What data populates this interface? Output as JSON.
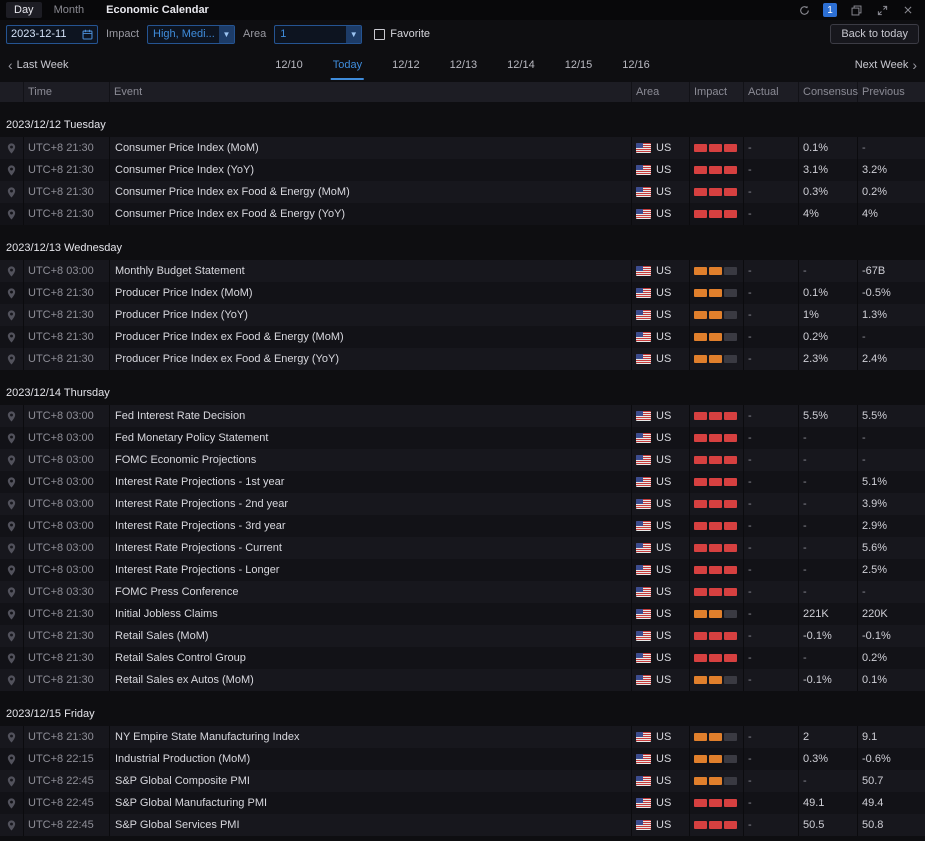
{
  "colors": {
    "accent": "#3f8cdb",
    "impact_high": "#d64040",
    "impact_medium": "#e07f2c"
  },
  "titlebar": {
    "tabs": [
      {
        "label": "Day",
        "active": true
      },
      {
        "label": "Month",
        "active": false
      }
    ],
    "title": "Economic Calendar",
    "window_count": "1"
  },
  "toolbar": {
    "date_value": "2023-12-11",
    "impact_label": "Impact",
    "impact_value": "High, Medi...",
    "area_label": "Area",
    "area_value": "1",
    "favorite_label": "Favorite",
    "back_to_today_label": "Back to today"
  },
  "week_nav": {
    "prev_label": "Last Week",
    "next_label": "Next Week",
    "days": [
      "12/10",
      "Today",
      "12/12",
      "12/13",
      "12/14",
      "12/15",
      "12/16"
    ],
    "active_index": 1
  },
  "table": {
    "columns": [
      "Time",
      "Event",
      "Area",
      "Impact",
      "Actual",
      "Consensus",
      "Previous"
    ],
    "sections": [
      {
        "date": "2023/12/12 Tuesday",
        "rows": [
          {
            "time": "UTC+8 21:30",
            "event": "Consumer Price Index (MoM)",
            "area": "US",
            "impact": "high",
            "actual": "-",
            "consensus": "0.1%",
            "previous": "-"
          },
          {
            "time": "UTC+8 21:30",
            "event": "Consumer Price Index (YoY)",
            "area": "US",
            "impact": "high",
            "actual": "-",
            "consensus": "3.1%",
            "previous": "3.2%"
          },
          {
            "time": "UTC+8 21:30",
            "event": "Consumer Price Index ex Food & Energy (MoM)",
            "area": "US",
            "impact": "high",
            "actual": "-",
            "consensus": "0.3%",
            "previous": "0.2%"
          },
          {
            "time": "UTC+8 21:30",
            "event": "Consumer Price Index ex Food & Energy (YoY)",
            "area": "US",
            "impact": "high",
            "actual": "-",
            "consensus": "4%",
            "previous": "4%"
          }
        ]
      },
      {
        "date": "2023/12/13 Wednesday",
        "rows": [
          {
            "time": "UTC+8 03:00",
            "event": "Monthly Budget Statement",
            "area": "US",
            "impact": "medium",
            "actual": "-",
            "consensus": "-",
            "previous": "-67B"
          },
          {
            "time": "UTC+8 21:30",
            "event": "Producer Price Index (MoM)",
            "area": "US",
            "impact": "medium",
            "actual": "-",
            "consensus": "0.1%",
            "previous": "-0.5%"
          },
          {
            "time": "UTC+8 21:30",
            "event": "Producer Price Index (YoY)",
            "area": "US",
            "impact": "medium",
            "actual": "-",
            "consensus": "1%",
            "previous": "1.3%"
          },
          {
            "time": "UTC+8 21:30",
            "event": "Producer Price Index ex Food & Energy (MoM)",
            "area": "US",
            "impact": "medium",
            "actual": "-",
            "consensus": "0.2%",
            "previous": "-"
          },
          {
            "time": "UTC+8 21:30",
            "event": "Producer Price Index ex Food & Energy (YoY)",
            "area": "US",
            "impact": "medium",
            "actual": "-",
            "consensus": "2.3%",
            "previous": "2.4%"
          }
        ]
      },
      {
        "date": "2023/12/14 Thursday",
        "rows": [
          {
            "time": "UTC+8 03:00",
            "event": "Fed Interest Rate Decision",
            "area": "US",
            "impact": "high",
            "actual": "-",
            "consensus": "5.5%",
            "previous": "5.5%"
          },
          {
            "time": "UTC+8 03:00",
            "event": "Fed Monetary Policy Statement",
            "area": "US",
            "impact": "high",
            "actual": "-",
            "consensus": "-",
            "previous": "-"
          },
          {
            "time": "UTC+8 03:00",
            "event": "FOMC Economic Projections",
            "area": "US",
            "impact": "high",
            "actual": "-",
            "consensus": "-",
            "previous": "-"
          },
          {
            "time": "UTC+8 03:00",
            "event": "Interest Rate Projections - 1st year",
            "area": "US",
            "impact": "high",
            "actual": "-",
            "consensus": "-",
            "previous": "5.1%"
          },
          {
            "time": "UTC+8 03:00",
            "event": "Interest Rate Projections - 2nd year",
            "area": "US",
            "impact": "high",
            "actual": "-",
            "consensus": "-",
            "previous": "3.9%"
          },
          {
            "time": "UTC+8 03:00",
            "event": "Interest Rate Projections - 3rd year",
            "area": "US",
            "impact": "high",
            "actual": "-",
            "consensus": "-",
            "previous": "2.9%"
          },
          {
            "time": "UTC+8 03:00",
            "event": "Interest Rate Projections - Current",
            "area": "US",
            "impact": "high",
            "actual": "-",
            "consensus": "-",
            "previous": "5.6%"
          },
          {
            "time": "UTC+8 03:00",
            "event": "Interest Rate Projections - Longer",
            "area": "US",
            "impact": "high",
            "actual": "-",
            "consensus": "-",
            "previous": "2.5%"
          },
          {
            "time": "UTC+8 03:30",
            "event": "FOMC Press Conference",
            "area": "US",
            "impact": "high",
            "actual": "-",
            "consensus": "-",
            "previous": "-"
          },
          {
            "time": "UTC+8 21:30",
            "event": "Initial Jobless Claims",
            "area": "US",
            "impact": "medium",
            "actual": "-",
            "consensus": "221K",
            "previous": "220K"
          },
          {
            "time": "UTC+8 21:30",
            "event": "Retail Sales (MoM)",
            "area": "US",
            "impact": "high",
            "actual": "-",
            "consensus": "-0.1%",
            "previous": "-0.1%"
          },
          {
            "time": "UTC+8 21:30",
            "event": "Retail Sales Control Group",
            "area": "US",
            "impact": "high",
            "actual": "-",
            "consensus": "-",
            "previous": "0.2%"
          },
          {
            "time": "UTC+8 21:30",
            "event": "Retail Sales ex Autos (MoM)",
            "area": "US",
            "impact": "medium",
            "actual": "-",
            "consensus": "-0.1%",
            "previous": "0.1%"
          }
        ]
      },
      {
        "date": "2023/12/15 Friday",
        "rows": [
          {
            "time": "UTC+8 21:30",
            "event": "NY Empire State Manufacturing Index",
            "area": "US",
            "impact": "medium",
            "actual": "-",
            "consensus": "2",
            "previous": "9.1"
          },
          {
            "time": "UTC+8 22:15",
            "event": "Industrial Production (MoM)",
            "area": "US",
            "impact": "medium",
            "actual": "-",
            "consensus": "0.3%",
            "previous": "-0.6%"
          },
          {
            "time": "UTC+8 22:45",
            "event": "S&P Global Composite PMI",
            "area": "US",
            "impact": "medium",
            "actual": "-",
            "consensus": "-",
            "previous": "50.7"
          },
          {
            "time": "UTC+8 22:45",
            "event": "S&P Global Manufacturing PMI",
            "area": "US",
            "impact": "high",
            "actual": "-",
            "consensus": "49.1",
            "previous": "49.4"
          },
          {
            "time": "UTC+8 22:45",
            "event": "S&P Global Services PMI",
            "area": "US",
            "impact": "high",
            "actual": "-",
            "consensus": "50.5",
            "previous": "50.8"
          }
        ]
      }
    ]
  }
}
